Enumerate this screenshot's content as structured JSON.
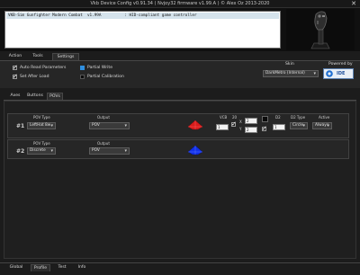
{
  "window": {
    "title": "Vkb Device Config v0.91.34 ( Nvjoy32 firmware v1.99.A ) © Alex Oz 2013-2020",
    "close_glyph": "✕"
  },
  "device_list": {
    "rows": [
      {
        "name": "VKB-Sim Gunfighter Modern Combat  v1.99A",
        "type": ": HID-compliant game controller"
      }
    ]
  },
  "top_tabs": [
    "Action",
    "Tools",
    "Settings"
  ],
  "active_top_tab": "Settings",
  "settings": {
    "checkboxes": [
      {
        "label": "Auto Read Parameters",
        "checked": true
      },
      {
        "label": "Set After Load",
        "checked": true
      }
    ],
    "legend": [
      {
        "label": "Partial Write",
        "color": "#2f8fe0"
      },
      {
        "label": "Partial Calibration",
        "color": "#111111"
      }
    ],
    "skin": {
      "label": "Skin",
      "value": "DarkMetro (Internal)"
    },
    "powered_by": {
      "label": "Powered by",
      "logo_text": "IDE"
    }
  },
  "sub_tabs": [
    "Axes",
    "Buttons",
    "POVs"
  ],
  "active_sub_tab": "POVs",
  "povs": [
    {
      "number": "#1",
      "pov_type_label": "POV Type",
      "pov_type": "LeftHat 8w",
      "output_label": "Output",
      "output": "POV",
      "color": "#d81c1c",
      "vcb_label": "VCB",
      "vcb_value": "1",
      "num_20": "20",
      "x_label": "X",
      "y_label": "Y",
      "x_value": "2",
      "y_value": "2",
      "d2_label": "D2",
      "d2_value": "1",
      "d2_type_label": "D2 Type",
      "d2_type": "Circle",
      "active_label": "Active",
      "active": "Always"
    },
    {
      "number": "#2",
      "pov_type_label": "POV Type",
      "pov_type": "Discrete",
      "output_label": "Output",
      "output": "POV",
      "color": "#1230e8"
    }
  ],
  "bottom_tabs": [
    "Global",
    "Profile",
    "Test",
    "Info"
  ],
  "active_bottom_tab": "Profile"
}
